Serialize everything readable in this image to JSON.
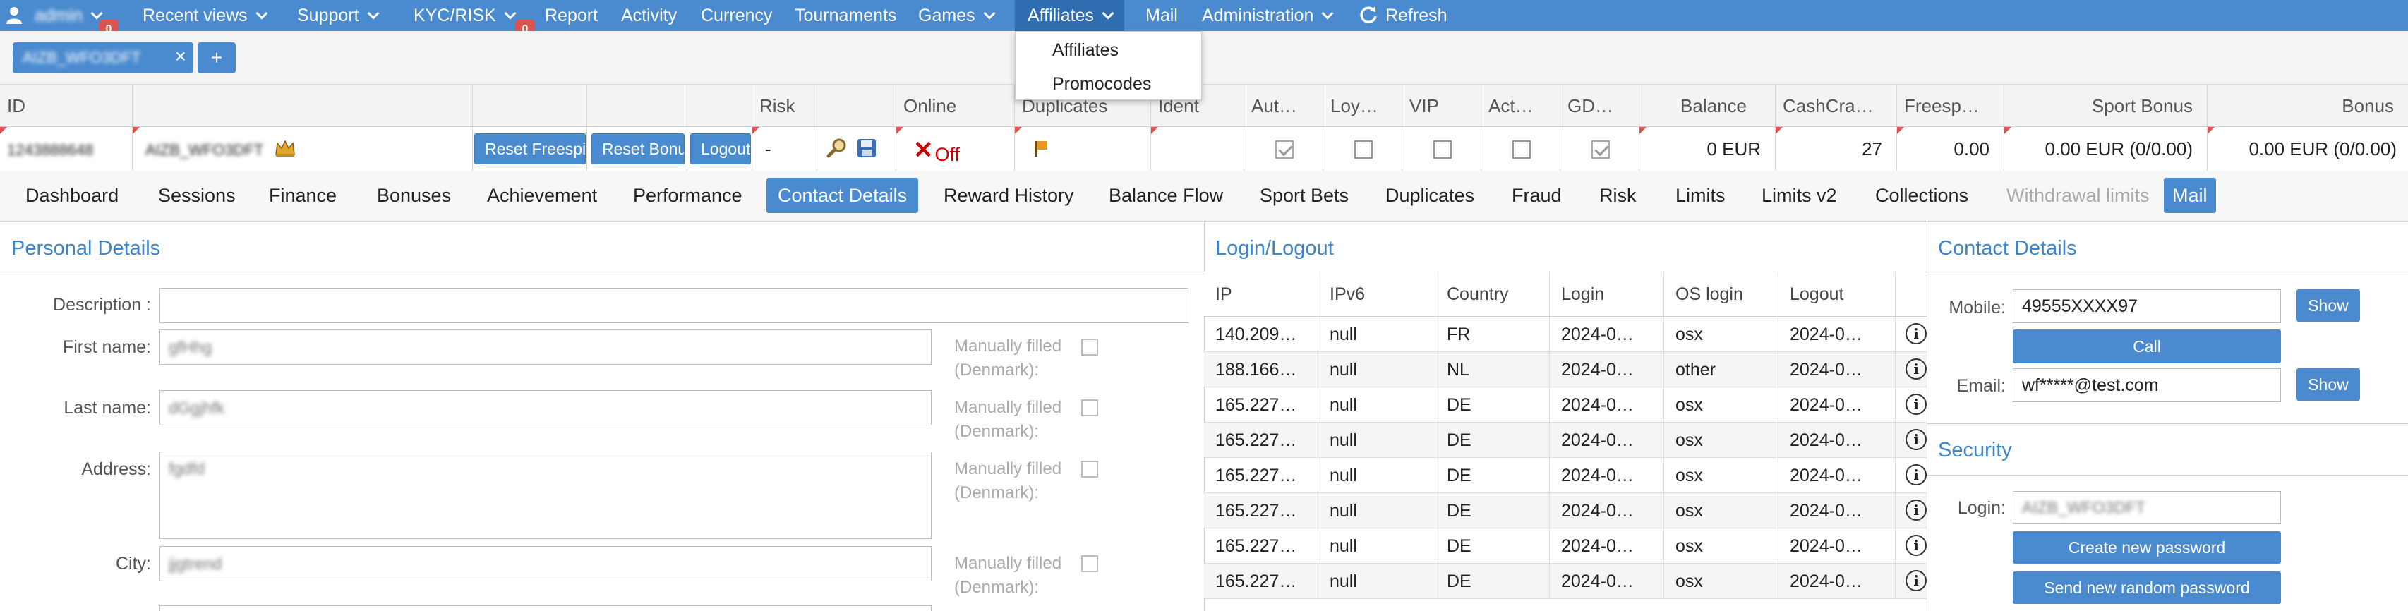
{
  "nav": {
    "user_label": "admin",
    "user_badge": "0",
    "items": [
      {
        "label": "Recent views"
      },
      {
        "label": "Support"
      },
      {
        "label": "KYC/RISK"
      },
      {
        "label": "Report"
      },
      {
        "label": "Activity"
      },
      {
        "label": "Currency"
      },
      {
        "label": "Tournaments"
      },
      {
        "label": "Games"
      },
      {
        "label": "Affiliates"
      },
      {
        "label": "Mail"
      },
      {
        "label": "Administration"
      },
      {
        "label": "Refresh"
      }
    ],
    "kyc_badge": "0",
    "affiliates_dropdown": [
      "Affiliates",
      "Promocodes"
    ]
  },
  "tabs": {
    "user_tab_label": "AIZB_WFO3DFT",
    "close": "×",
    "add": "+"
  },
  "summary": {
    "headers": [
      "ID",
      "",
      "",
      "",
      "",
      "Risk",
      "",
      "Online",
      "Duplicates",
      "Ident",
      "Aut…",
      "Loy…",
      "VIP",
      "Act…",
      "GD…",
      "Balance",
      "CashCra…",
      "Freesp…",
      "Sport Bonus",
      "Bonus"
    ],
    "row": {
      "id": "1243888648",
      "username": "AIZB_WFO3DFT",
      "buttons": [
        "Reset Freespins",
        "Reset Bonus",
        "Logout"
      ],
      "risk": "-",
      "online": "Off",
      "balance": "0 EUR",
      "cashcrash": "27",
      "freespins": "0.00",
      "sport_bonus": "0.00 EUR (0/0.00)",
      "bonus": "0.00 EUR (0/0.00)"
    },
    "checkboxes": {
      "aut": true,
      "loy": false,
      "vip": false,
      "act": false,
      "gd": true
    }
  },
  "subnav": [
    "Dashboard",
    "Sessions",
    "Finance",
    "Bonuses",
    "Achievement",
    "Performance",
    "Contact Details",
    "Reward History",
    "Balance Flow",
    "Sport Bets",
    "Duplicates",
    "Fraud",
    "Risk",
    "Limits",
    "Limits v2",
    "Collections",
    "Withdrawal limits",
    "Mail"
  ],
  "personal": {
    "title": "Personal Details",
    "description_label": "Description :",
    "first_name_label": "First name:",
    "first_name_value": "gfHhg",
    "last_name_label": "Last name:",
    "last_name_value": "dGgjhfk",
    "address_label": "Address:",
    "address_value": "fgdfd",
    "city_label": "City:",
    "city_value": "jjgtrend",
    "manual_line1": "Manually filled",
    "manual_line2": "(Denmark):"
  },
  "login": {
    "title": "Login/Logout",
    "headers": [
      "IP",
      "IPv6",
      "Country",
      "Login",
      "OS login",
      "Logout",
      ""
    ],
    "rows": [
      {
        "ip": "140.209…",
        "ipv6": "null",
        "country": "FR",
        "login": "2024-0…",
        "os": "osx",
        "logout": "2024-0…"
      },
      {
        "ip": "188.166…",
        "ipv6": "null",
        "country": "NL",
        "login": "2024-0…",
        "os": "other",
        "logout": "2024-0…"
      },
      {
        "ip": "165.227…",
        "ipv6": "null",
        "country": "DE",
        "login": "2024-0…",
        "os": "osx",
        "logout": "2024-0…"
      },
      {
        "ip": "165.227…",
        "ipv6": "null",
        "country": "DE",
        "login": "2024-0…",
        "os": "osx",
        "logout": "2024-0…"
      },
      {
        "ip": "165.227…",
        "ipv6": "null",
        "country": "DE",
        "login": "2024-0…",
        "os": "osx",
        "logout": "2024-0…"
      },
      {
        "ip": "165.227…",
        "ipv6": "null",
        "country": "DE",
        "login": "2024-0…",
        "os": "osx",
        "logout": "2024-0…"
      },
      {
        "ip": "165.227…",
        "ipv6": "null",
        "country": "DE",
        "login": "2024-0…",
        "os": "osx",
        "logout": "2024-0…"
      },
      {
        "ip": "165.227…",
        "ipv6": "null",
        "country": "DE",
        "login": "2024-0…",
        "os": "osx",
        "logout": "2024-0…"
      }
    ]
  },
  "contact": {
    "title": "Contact Details",
    "mobile_label": "Mobile:",
    "mobile_value": "49555XXXX97",
    "show_label": "Show",
    "call_label": "Call",
    "email_label": "Email:",
    "email_value": "wf*****@test.com",
    "security_title": "Security",
    "login_label": "Login:",
    "login_value": "AIZB_WFO3DFT",
    "create_password": "Create new password",
    "send_password": "Send new random password"
  },
  "colors": {
    "accent": "#4a8bd0",
    "nav_active": "#2f6fb1",
    "badge": "#d9534f",
    "danger": "#cc0000",
    "panel_title": "#3d86cc"
  }
}
